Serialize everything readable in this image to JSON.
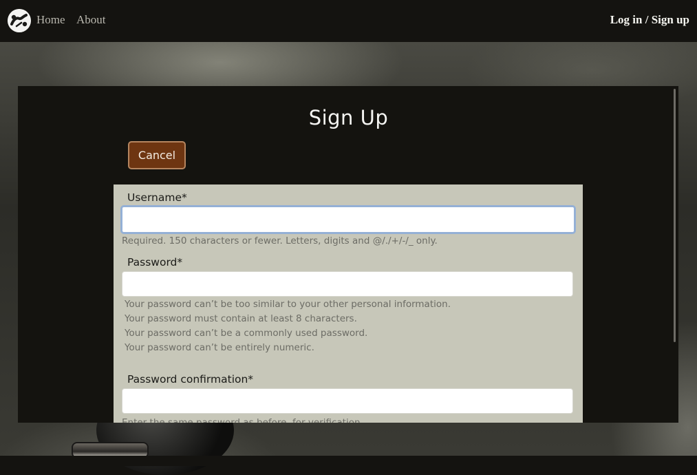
{
  "nav": {
    "home_label": "Home",
    "about_label": "About",
    "auth_label": "Log in / Sign up"
  },
  "page": {
    "title": "Sign Up",
    "cancel_label": "Cancel"
  },
  "form": {
    "username_label": "Username*",
    "username_value": "",
    "username_help": "Required. 150 characters or fewer. Letters, digits and @/./+/-/_ only.",
    "password_label": "Password*",
    "password_value": "",
    "password_help": [
      "Your password can’t be too similar to your other personal information.",
      "Your password must contain at least 8 characters.",
      "Your password can’t be a commonly used password.",
      "Your password can’t be entirely numeric."
    ],
    "password_confirmation_label": "Password confirmation*",
    "password_confirmation_value": "",
    "password_confirmation_help": "Enter the same password as before, for verification."
  },
  "icons": {
    "logo": "dumbbell-logo-icon"
  },
  "colors": {
    "navbar_bg": "#141310",
    "panel_bg": "#14130f",
    "form_bg": "#c7c7b9",
    "cancel_bg": "#6e3511",
    "cancel_border": "#b5855f",
    "focus_ring": "#94b0d6"
  }
}
